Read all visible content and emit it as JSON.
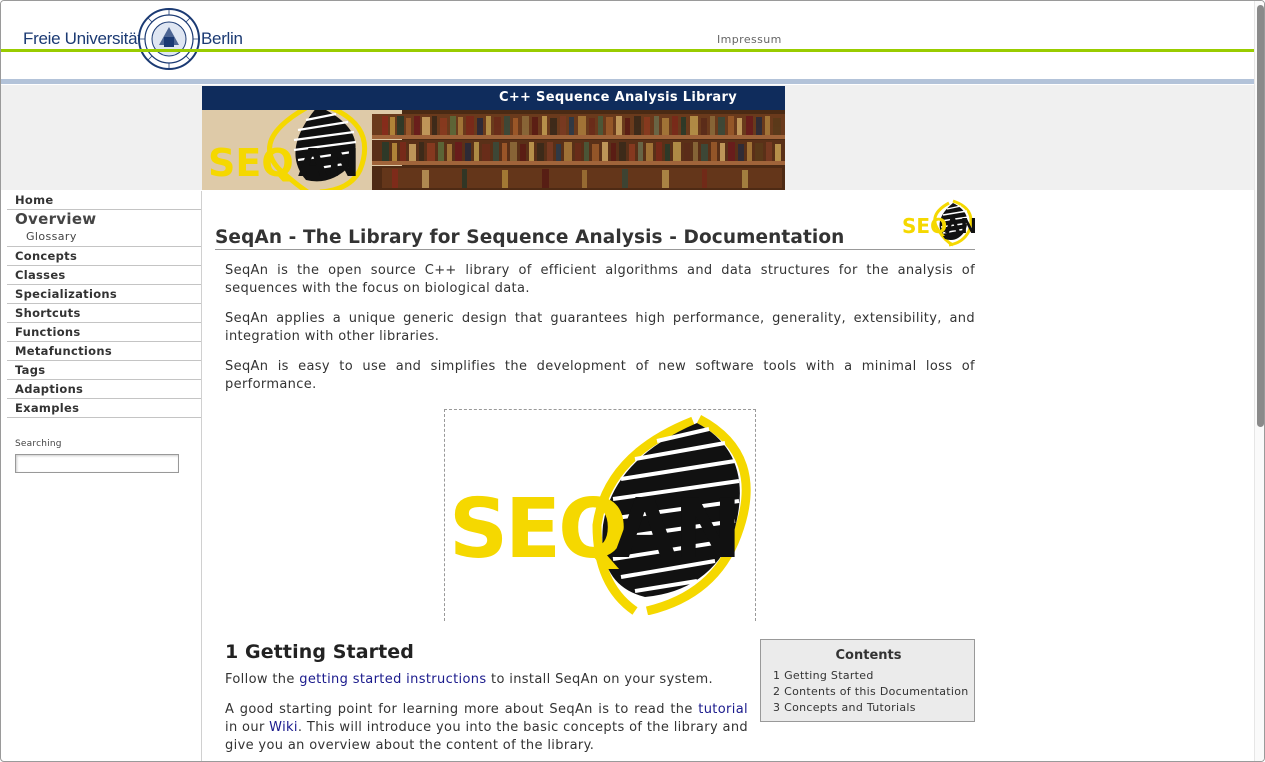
{
  "header": {
    "university_left": "Freie Universität",
    "university_right": "Berlin",
    "impressum_link": "Impressum"
  },
  "banner": {
    "title": "C++ Sequence Analysis Library",
    "logo_text_seq": "SEQ",
    "logo_text_an": "AN"
  },
  "nav": {
    "items": [
      {
        "label": "Home"
      },
      {
        "label": "Overview"
      },
      {
        "label": "Glossary"
      },
      {
        "label": "Concepts"
      },
      {
        "label": "Classes"
      },
      {
        "label": "Specializations"
      },
      {
        "label": "Shortcuts"
      },
      {
        "label": "Functions"
      },
      {
        "label": "Metafunctions"
      },
      {
        "label": "Tags"
      },
      {
        "label": "Adaptions"
      },
      {
        "label": "Examples"
      }
    ],
    "search_label": "Searching",
    "search_value": ""
  },
  "main": {
    "title": "SeqAn - The Library for Sequence Analysis - Documentation",
    "intro_paragraphs": [
      "SeqAn is the open source C++ library of efficient algorithms and data structures for the analysis of sequences with the focus on biological data.",
      "SeqAn applies a unique generic design that guarantees high performance, generality, extensibility, and integration with other libraries.",
      "SeqAn is easy to use and simplifies the development of new software tools with a minimal loss of performance."
    ],
    "section_heading": "1 Getting Started",
    "getting_started": {
      "p1_before": "Follow the ",
      "p1_link": "getting started instructions",
      "p1_after": " to install SeqAn on your system.",
      "p2_before": "A good starting point for learning more about SeqAn is to read the ",
      "p2_link1": "tutorial",
      "p2_mid": " in our ",
      "p2_link2": "Wiki",
      "p2_after": ". This will introduce you into the basic concepts of the library and give you an overview about the content of the library."
    }
  },
  "toc": {
    "title": "Contents",
    "items": [
      "1 Getting Started",
      "2 Contents of this Documentation",
      "3 Concepts and Tutorials"
    ]
  },
  "colors": {
    "green_line": "#99cc00",
    "navy_banner": "#0f2c5c",
    "link": "#1a1a8c",
    "logo_yellow": "#f5d800"
  }
}
